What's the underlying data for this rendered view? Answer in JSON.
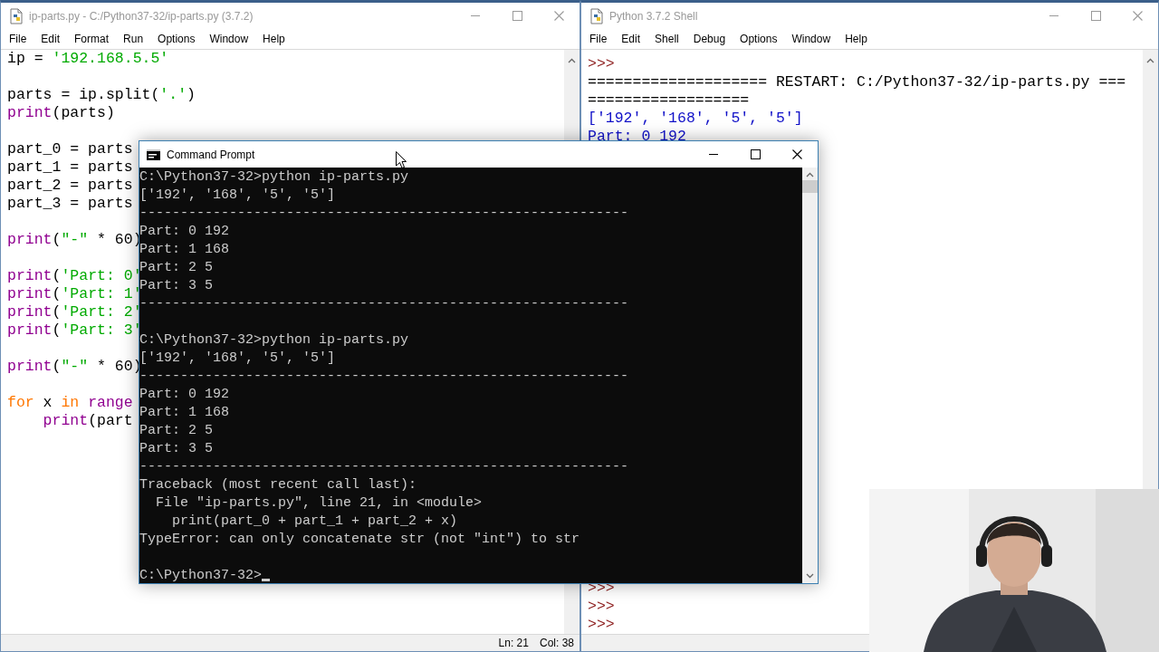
{
  "editor": {
    "title": "ip-parts.py - C:/Python37-32/ip-parts.py (3.7.2)",
    "active": false,
    "menu": [
      "File",
      "Edit",
      "Format",
      "Run",
      "Options",
      "Window",
      "Help"
    ],
    "lines": [
      {
        "kind": "code",
        "tokens": [
          {
            "kind": "plain",
            "text": "ip = "
          },
          {
            "kind": "string",
            "text": "'192.168.5.5'"
          }
        ]
      },
      {
        "kind": "blank"
      },
      {
        "kind": "code",
        "tokens": [
          {
            "kind": "plain",
            "text": "parts = ip.split("
          },
          {
            "kind": "string",
            "text": "'.'"
          },
          {
            "kind": "plain",
            "text": ")"
          }
        ]
      },
      {
        "kind": "code",
        "tokens": [
          {
            "kind": "builtin",
            "text": "print"
          },
          {
            "kind": "plain",
            "text": "(parts)"
          }
        ]
      },
      {
        "kind": "blank"
      },
      {
        "kind": "code",
        "tokens": [
          {
            "kind": "plain",
            "text": "part_0 = parts"
          }
        ]
      },
      {
        "kind": "code",
        "tokens": [
          {
            "kind": "plain",
            "text": "part_1 = parts"
          }
        ]
      },
      {
        "kind": "code",
        "tokens": [
          {
            "kind": "plain",
            "text": "part_2 = parts"
          }
        ]
      },
      {
        "kind": "code",
        "tokens": [
          {
            "kind": "plain",
            "text": "part_3 = parts"
          }
        ]
      },
      {
        "kind": "blank"
      },
      {
        "kind": "code",
        "tokens": [
          {
            "kind": "builtin",
            "text": "print"
          },
          {
            "kind": "plain",
            "text": "("
          },
          {
            "kind": "string",
            "text": "\"-\""
          },
          {
            "kind": "plain",
            "text": " * 60)"
          }
        ]
      },
      {
        "kind": "blank"
      },
      {
        "kind": "code",
        "tokens": [
          {
            "kind": "builtin",
            "text": "print"
          },
          {
            "kind": "plain",
            "text": "("
          },
          {
            "kind": "string",
            "text": "'Part: 0'"
          }
        ]
      },
      {
        "kind": "code",
        "tokens": [
          {
            "kind": "builtin",
            "text": "print"
          },
          {
            "kind": "plain",
            "text": "("
          },
          {
            "kind": "string",
            "text": "'Part: 1'"
          }
        ]
      },
      {
        "kind": "code",
        "tokens": [
          {
            "kind": "builtin",
            "text": "print"
          },
          {
            "kind": "plain",
            "text": "("
          },
          {
            "kind": "string",
            "text": "'Part: 2'"
          }
        ]
      },
      {
        "kind": "code",
        "tokens": [
          {
            "kind": "builtin",
            "text": "print"
          },
          {
            "kind": "plain",
            "text": "("
          },
          {
            "kind": "string",
            "text": "'Part: 3'"
          }
        ]
      },
      {
        "kind": "blank"
      },
      {
        "kind": "code",
        "tokens": [
          {
            "kind": "builtin",
            "text": "print"
          },
          {
            "kind": "plain",
            "text": "("
          },
          {
            "kind": "string",
            "text": "\"-\""
          },
          {
            "kind": "plain",
            "text": " * 60)"
          }
        ]
      },
      {
        "kind": "blank"
      },
      {
        "kind": "code",
        "tokens": [
          {
            "kind": "keyword",
            "text": "for"
          },
          {
            "kind": "plain",
            "text": " x "
          },
          {
            "kind": "keyword",
            "text": "in"
          },
          {
            "kind": "builtin",
            "text": " range"
          }
        ]
      },
      {
        "kind": "code",
        "tokens": [
          {
            "kind": "builtin",
            "text": "    print"
          },
          {
            "kind": "plain",
            "text": "(part"
          }
        ]
      }
    ],
    "status": {
      "line": "Ln: 21",
      "column": "Col: 38"
    }
  },
  "shell": {
    "title": "Python 3.7.2 Shell",
    "active": false,
    "menu": [
      "File",
      "Edit",
      "Shell",
      "Debug",
      "Options",
      "Window",
      "Help"
    ],
    "lines_top": [
      {
        "kind": "prompt",
        "text": ">>>"
      },
      {
        "kind": "restart",
        "text": "==================== RESTART: C:/Python37-32/ip-parts.py ==="
      },
      {
        "kind": "restart",
        "text": "=================="
      },
      {
        "kind": "output",
        "text": "['192', '168', '5', '5']"
      },
      {
        "kind": "output",
        "text": "Part: 0 192"
      }
    ],
    "lines_bottom": [
      {
        "kind": "prompt",
        "text": ">>>"
      },
      {
        "kind": "prompt",
        "text": ">>>"
      },
      {
        "kind": "prompt",
        "text": ">>>"
      }
    ]
  },
  "console": {
    "title": "Command Prompt",
    "active": true,
    "lines": [
      {
        "kind": "text",
        "text": "C:\\Python37-32>python ip-parts.py"
      },
      {
        "kind": "text",
        "text": "['192', '168', '5', '5']"
      },
      {
        "kind": "text",
        "text": "------------------------------------------------------------"
      },
      {
        "kind": "text",
        "text": "Part: 0 192"
      },
      {
        "kind": "text",
        "text": "Part: 1 168"
      },
      {
        "kind": "text",
        "text": "Part: 2 5"
      },
      {
        "kind": "text",
        "text": "Part: 3 5"
      },
      {
        "kind": "text",
        "text": "------------------------------------------------------------"
      },
      {
        "kind": "blank"
      },
      {
        "kind": "text",
        "text": "C:\\Python37-32>python ip-parts.py"
      },
      {
        "kind": "text",
        "text": "['192', '168', '5', '5']"
      },
      {
        "kind": "text",
        "text": "------------------------------------------------------------"
      },
      {
        "kind": "text",
        "text": "Part: 0 192"
      },
      {
        "kind": "text",
        "text": "Part: 1 168"
      },
      {
        "kind": "text",
        "text": "Part: 2 5"
      },
      {
        "kind": "text",
        "text": "Part: 3 5"
      },
      {
        "kind": "text",
        "text": "------------------------------------------------------------"
      },
      {
        "kind": "text",
        "text": "Traceback (most recent call last):"
      },
      {
        "kind": "text",
        "text": "  File \"ip-parts.py\", line 21, in <module>"
      },
      {
        "kind": "text",
        "text": "    print(part_0 + part_1 + part_2 + x)"
      },
      {
        "kind": "text",
        "text": "TypeError: can only concatenate str (not \"int\") to str"
      },
      {
        "kind": "blank"
      },
      {
        "kind": "text",
        "text": "C:\\Python37-32>"
      }
    ]
  }
}
